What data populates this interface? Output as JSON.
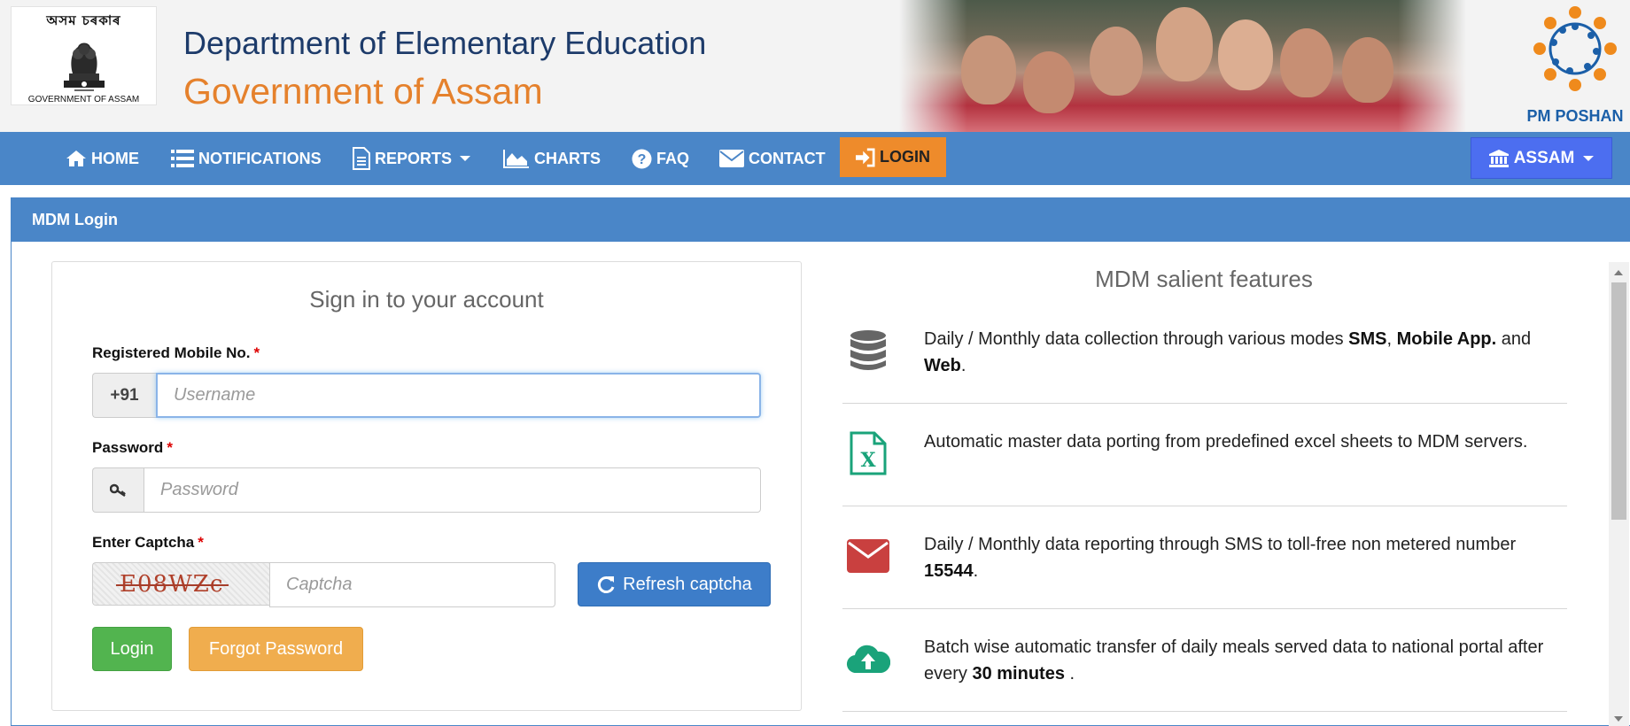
{
  "header": {
    "emblem_script": "অসম চৰকাৰ",
    "emblem_caption": "GOVERNMENT OF ASSAM",
    "title": "Department of Elementary Education",
    "subtitle": "Government of Assam",
    "poshan_label": "PM POSHAN"
  },
  "nav": {
    "items": [
      {
        "label": "HOME",
        "icon": "home-icon"
      },
      {
        "label": "NOTIFICATIONS",
        "icon": "list-icon"
      },
      {
        "label": "REPORTS",
        "icon": "file-icon"
      },
      {
        "label": "CHARTS",
        "icon": "area-chart-icon"
      },
      {
        "label": "FAQ",
        "icon": "question-circle-icon"
      },
      {
        "label": "CONTACT",
        "icon": "envelope-icon"
      },
      {
        "label": "LOGIN",
        "icon": "sign-in-icon"
      }
    ],
    "active": "LOGIN",
    "state_label": "ASSAM",
    "colors": {
      "bar": "#4a86c8",
      "active": "#ee8b2b",
      "state": "#4c6ef0"
    }
  },
  "panel": {
    "heading": "MDM Login"
  },
  "login": {
    "title": "Sign in to your account",
    "mobile_label": "Registered Mobile No.",
    "required_mark": "*",
    "country_code": "+91",
    "username_placeholder": "Username",
    "password_label": "Password",
    "password_placeholder": "Password",
    "captcha_label": "Enter Captcha",
    "captcha_text": "E08WZc",
    "captcha_placeholder": "Captcha",
    "refresh_label": "Refresh captcha",
    "login_label": "Login",
    "forgot_label": "Forgot Password"
  },
  "features": {
    "title": "MDM salient features",
    "items": [
      {
        "icon": "database-icon",
        "pre": "Daily / Monthly data collection through various modes ",
        "b1": "SMS",
        "mid1": ", ",
        "b2": "Mobile App.",
        "mid2": " and ",
        "b3": "Web",
        "post": "."
      },
      {
        "icon": "excel-file-icon",
        "text": "Automatic master data porting from predefined excel sheets to MDM servers."
      },
      {
        "icon": "envelope-icon",
        "pre": "Daily / Monthly data reporting through SMS to toll-free non metered number ",
        "b1": "15544",
        "post": "."
      },
      {
        "icon": "cloud-upload-icon",
        "pre": "Batch wise automatic transfer of daily meals served data to national portal after every ",
        "b1": "30 minutes",
        "post": " ."
      }
    ]
  }
}
